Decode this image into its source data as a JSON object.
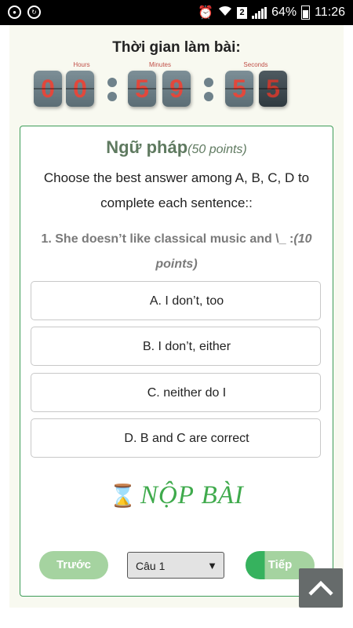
{
  "status_bar": {
    "left_icons": [
      "account-icon",
      "sync-icon"
    ],
    "right_icons": [
      "alarm-icon",
      "wifi-icon",
      "sim-2-icon",
      "signal-icon",
      "battery-icon"
    ],
    "sim_label": "2",
    "battery": "64%",
    "time": "11:26"
  },
  "timer": {
    "title": "Thời gian làm bài:",
    "hours_label": "Hours",
    "minutes_label": "Minutes",
    "seconds_label": "Seconds",
    "digits": [
      "0",
      "0",
      "5",
      "9",
      "5",
      "5"
    ],
    "digit_color": "#e2483c"
  },
  "section": {
    "name": "Ngữ pháp",
    "points": "(50 points)",
    "instruction": "Choose the best answer among A, B, C, D to complete each sentence::"
  },
  "question": {
    "text": "1. She doesn’t like classical music and \\_ :",
    "points": "(10 points)"
  },
  "options": [
    {
      "label": "A. I don’t, too"
    },
    {
      "label": "B. I don’t, either"
    },
    {
      "label": "C. neither do I"
    },
    {
      "label": "D. B and C are correct"
    }
  ],
  "submit": {
    "icon": "hourglass-icon",
    "label": "NỘP BÀI"
  },
  "nav": {
    "prev": "Trước",
    "select_value": "Câu 1",
    "next": "Tiếp"
  },
  "colors": {
    "accent_green": "#3faa4c",
    "border_green": "#3d9c58",
    "section_title": "#5f7a60"
  },
  "scroll_top_icon": "chevron-up-icon"
}
